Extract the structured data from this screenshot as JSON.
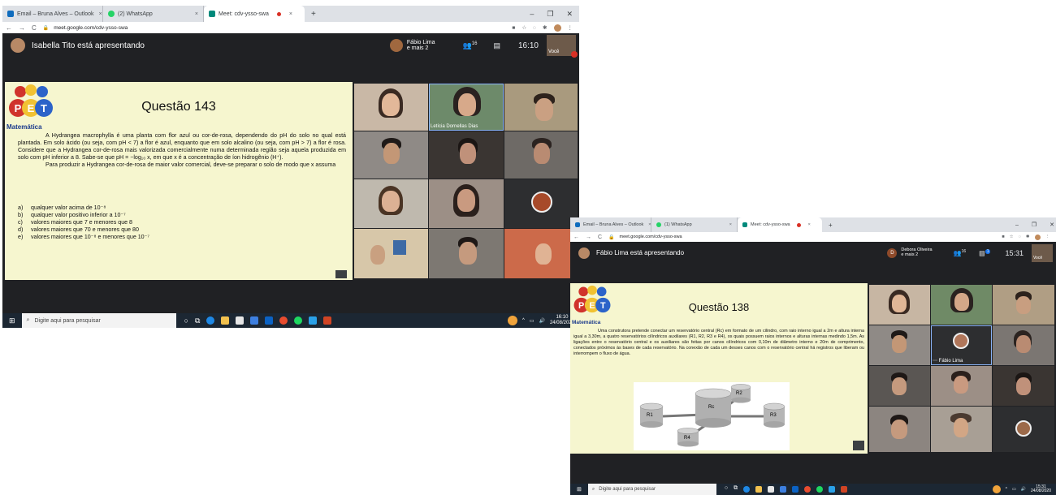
{
  "colors": {
    "meet_dark": "#202124",
    "slide_bg": "#f6f6cf",
    "pet_blue": "#1b3a8c",
    "pet_red": "#d0332c",
    "taskbar": "#1c2733"
  },
  "screenshot1": {
    "tabs": [
      {
        "label": "Email – Bruna Alves – Outlook",
        "icon": "outlook-icon"
      },
      {
        "label": "(2) WhatsApp",
        "icon": "whatsapp-icon"
      },
      {
        "label": "Meet: cdv-ysso-swa",
        "icon": "meet-icon",
        "active": true
      }
    ],
    "url": "meet.google.com/cdv-ysso-swa",
    "presenting_text": "Isabella Tito está apresentando",
    "others_name": "Fábio Lima",
    "others_more": "e mais 2",
    "participants_count": "16",
    "clock": "16:10",
    "self_label": "Você",
    "slide": {
      "logo_text": "Matemática",
      "title": "Questão 143",
      "paragraph1": "A Hydrangea macrophylla é uma planta com flor azul ou cor-de-rosa, dependendo do pH do solo no qual está plantada. Em solo ácido (ou seja, com pH < 7) a flor é azul, enquanto que em solo alcalino (ou seja, com pH > 7) a flor é rosa. Considere que a Hydrangea cor-de-rosa mais valorizada comercialmente numa determinada região seja aquela produzida em solo com pH inferior a 8. Sabe-se que pH = −log₁₀ x, em que x é a concentração de íon hidrogênio (H⁺).",
      "paragraph2": "Para produzir a Hydrangea cor-de-rosa de maior valor comercial, deve-se preparar o solo de modo que x assuma",
      "options": [
        {
          "letter": "a)",
          "text": "qualquer valor acima de 10⁻⁸"
        },
        {
          "letter": "b)",
          "text": "qualquer valor positivo inferior a 10⁻⁷"
        },
        {
          "letter": "c)",
          "text": "valores maiores que 7 e menores que 8"
        },
        {
          "letter": "d)",
          "text": "valores maiores que 70 e menores que 80"
        },
        {
          "letter": "e)",
          "text": "valores maiores que 10⁻⁸ e menores que 10⁻⁷"
        }
      ]
    },
    "highlight_tile_name": "Letícia Dornellas Dias",
    "taskbar": {
      "search_placeholder": "Digite aqui para pesquisar",
      "time": "16:10",
      "date": "24/08/2020"
    }
  },
  "screenshot2": {
    "tabs": [
      {
        "label": "Email – Bruna Alves – Outlook",
        "icon": "outlook-icon"
      },
      {
        "label": "(1) WhatsApp",
        "icon": "whatsapp-icon"
      },
      {
        "label": "Meet: cdv-ysso-swa",
        "icon": "meet-icon",
        "active": true
      }
    ],
    "url": "meet.google.com/cdv-ysso-swa",
    "presenting_text": "Fábio Lima está apresentando",
    "others_initial": "D",
    "others_name": "Debora Oliveira",
    "others_more": "e mais 2",
    "participants_count": "16",
    "chat_badge": "1",
    "clock": "15:31",
    "self_label": "Você",
    "slide": {
      "logo_text": "Matemática",
      "title": "Questão 138",
      "paragraph1": "Uma construtora pretende conectar um reservatório central (Rc) em formato de um cilindro, com raio interno igual a 2m e altura interna igual a 3,30m, a quatro reservatórios cilíndricos auxiliares (R1, R2, R3 e R4), os quais possuem raios internos e alturas internas medindo 1,5m. As ligações entre o reservatório central e os auxiliares são feitas por canos cilíndricos com 0,10m de diâmetro interno e 20m de comprimento, conectados próximos às bases de cada reservatório. Na conexão de cada um desses canos com o reservatório central há registros que liberam ou interrompem o fluxo de água.",
      "diagram_labels": {
        "rc": "Rc",
        "r1": "R1",
        "r2": "R2",
        "r3": "R3",
        "r4": "R4"
      }
    },
    "highlight_tile_name": "Fábio Lima",
    "taskbar": {
      "search_placeholder": "Digite aqui para pesquisar",
      "time": "15:31",
      "date": "24/08/2020"
    }
  }
}
